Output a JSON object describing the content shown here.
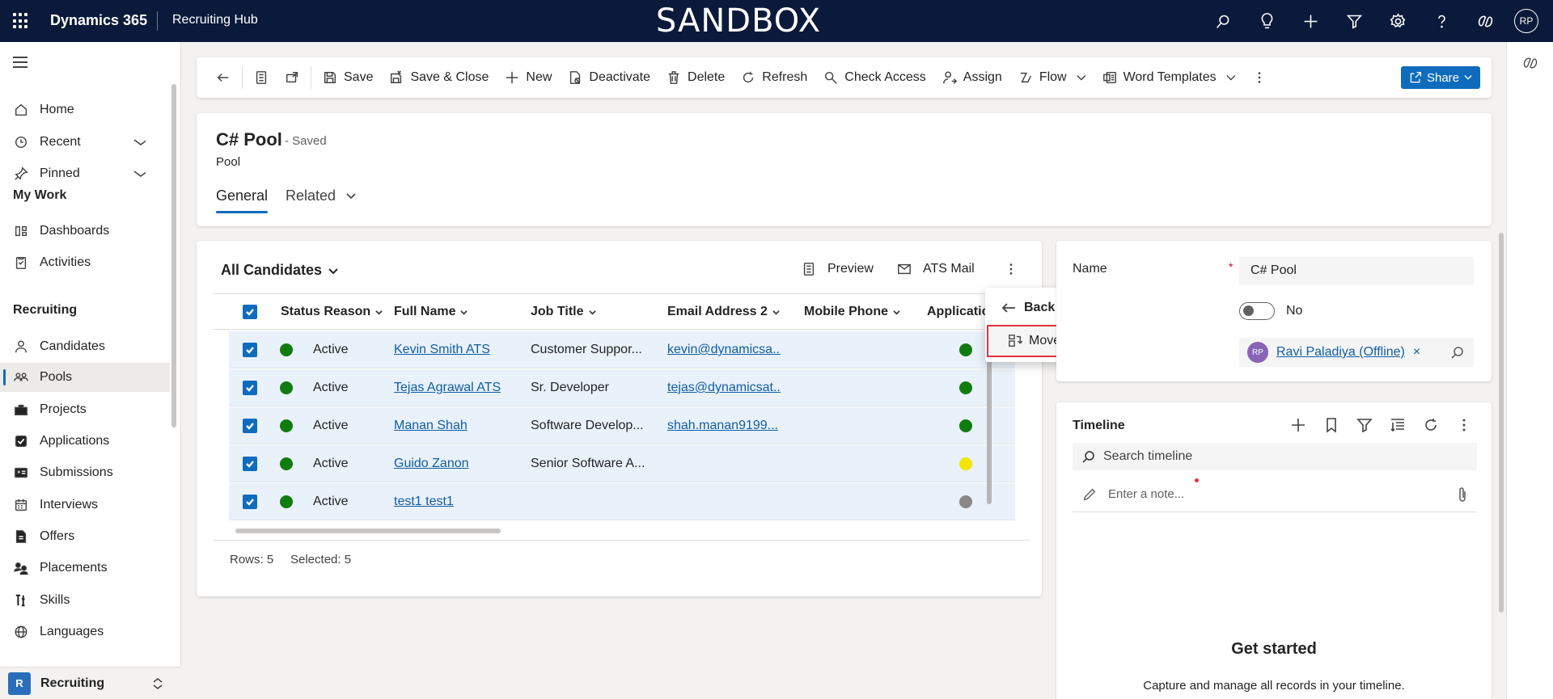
{
  "topbar": {
    "brand": "Dynamics 365",
    "app_name": "Recruiting Hub",
    "environment_banner": "SANDBOX",
    "user_initials": "RP",
    "icons": [
      "search-icon",
      "lightbulb-icon",
      "plus-icon",
      "filter-icon",
      "gear-icon",
      "help-icon",
      "copilot-icon"
    ]
  },
  "sidebar": {
    "items_top": [
      {
        "label": "Home",
        "icon": "home-icon"
      },
      {
        "label": "Recent",
        "icon": "clock-icon"
      },
      {
        "label": "Pinned",
        "icon": "pin-icon"
      }
    ],
    "group_my_work": "My Work",
    "items_my_work": [
      {
        "label": "Dashboards",
        "icon": "dashboard-icon"
      },
      {
        "label": "Activities",
        "icon": "clipboard-icon"
      }
    ],
    "group_recruiting": "Recruiting",
    "items_recruiting": [
      {
        "label": "Candidates",
        "icon": "person-icon"
      },
      {
        "label": "Pools",
        "icon": "people-icon"
      },
      {
        "label": "Projects",
        "icon": "briefcase-icon"
      },
      {
        "label": "Applications",
        "icon": "checkbox-icon"
      },
      {
        "label": "Submissions",
        "icon": "id-card-icon"
      },
      {
        "label": "Interviews",
        "icon": "calendar-icon"
      },
      {
        "label": "Offers",
        "icon": "document-icon"
      },
      {
        "label": "Placements",
        "icon": "people-swap-icon"
      },
      {
        "label": "Skills",
        "icon": "skills-icon"
      },
      {
        "label": "Languages",
        "icon": "globe-icon"
      }
    ],
    "area_badge": "R",
    "area_label": "Recruiting"
  },
  "commandbar": {
    "save": "Save",
    "save_close": "Save & Close",
    "new": "New",
    "deactivate": "Deactivate",
    "delete": "Delete",
    "refresh": "Refresh",
    "check_access": "Check Access",
    "assign": "Assign",
    "flow": "Flow",
    "word_templates": "Word Templates",
    "share": "Share"
  },
  "record": {
    "title": "C# Pool",
    "save_state": "- Saved",
    "entity": "Pool",
    "tab_general": "General",
    "tab_related": "Related"
  },
  "grid": {
    "view_name": "All Candidates",
    "action_preview": "Preview",
    "action_ats_mail": "ATS Mail",
    "columns": [
      "Status Reason",
      "Full Name",
      "Job Title",
      "Email Address 2",
      "Mobile Phone",
      "Applicatio"
    ],
    "rows": [
      {
        "status": "Active",
        "name": "Kevin Smith ATS",
        "job": "Customer Suppor...",
        "email": "kevin@dynamicsa...",
        "phone": "",
        "app_color": "#107c10"
      },
      {
        "status": "Active",
        "name": "Tejas Agrawal ATS",
        "job": "Sr. Developer",
        "email": "tejas@dynamicsat...",
        "phone": "",
        "app_color": "#107c10"
      },
      {
        "status": "Active",
        "name": "Manan Shah",
        "job": "Software Develop...",
        "email": "shah.manan9199...",
        "phone": "",
        "app_color": "#107c10"
      },
      {
        "status": "Active",
        "name": "Guido Zanon",
        "job": "Senior Software A...",
        "email": "",
        "phone": "",
        "app_color": "#f2e600"
      },
      {
        "status": "Active",
        "name": "test1 test1",
        "job": "",
        "email": "",
        "phone": "",
        "app_color": "#8a8886"
      }
    ],
    "status_color": "#107c10",
    "rows_label": "Rows: 5",
    "selected_label": "Selected: 5"
  },
  "flyout": {
    "back": "Back",
    "move": "Move"
  },
  "form": {
    "name_label": "Name",
    "required_marker": "*",
    "name_value": "C# Pool",
    "toggle_label": "No",
    "owner_initials": "RP",
    "owner_name": "Ravi Paladiya (Offline)",
    "owner_remove": "×"
  },
  "timeline": {
    "title": "Timeline",
    "search_placeholder": "Search timeline",
    "note_placeholder": "Enter a note...",
    "empty_title": "Get started",
    "empty_subtitle": "Capture and manage all records in your timeline."
  },
  "colors": {
    "topbar": "#0b1a3a",
    "accent": "#0f6cbd",
    "highlight_border": "#e0333a"
  }
}
